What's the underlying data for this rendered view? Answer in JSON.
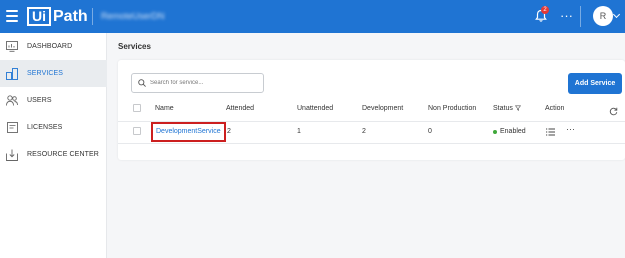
{
  "topbar": {
    "logo_ui": "Ui",
    "logo_path": "Path",
    "tenant": "RemoteUserDN",
    "notification_count": "2",
    "more": "···",
    "avatar_initial": "R"
  },
  "sidebar": {
    "items": [
      {
        "label": "DASHBOARD",
        "icon": "dashboard-icon"
      },
      {
        "label": "SERVICES",
        "icon": "services-icon",
        "active": true
      },
      {
        "label": "USERS",
        "icon": "users-icon"
      },
      {
        "label": "LICENSES",
        "icon": "licenses-icon"
      },
      {
        "label": "RESOURCE CENTER",
        "icon": "resource-center-icon"
      }
    ]
  },
  "main": {
    "title": "Services",
    "search": {
      "placeholder": "Search for service..."
    },
    "add_button": "Add Service",
    "columns": [
      "Name",
      "Attended",
      "Unattended",
      "Development",
      "Non Production",
      "Status",
      "Action"
    ],
    "rows": [
      {
        "name": "DevelopmentService",
        "attended": "2",
        "unattended": "1",
        "development": "2",
        "non_production": "0",
        "status": "Enabled"
      }
    ]
  },
  "colors": {
    "accent": "#1f74d3",
    "status_enabled": "#3fa83a",
    "highlight_border": "#cc1f1f"
  }
}
